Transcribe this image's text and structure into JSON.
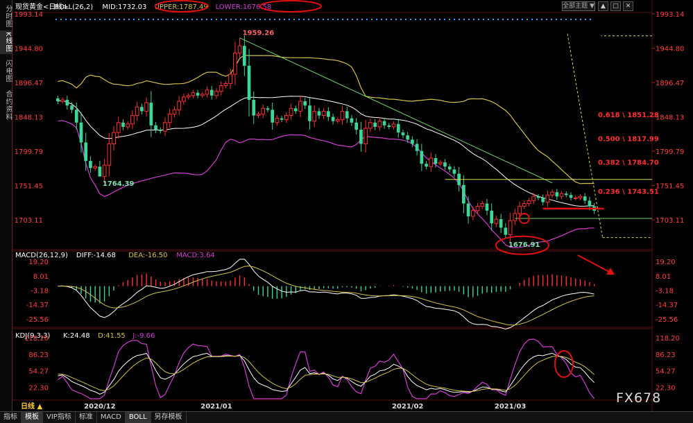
{
  "sidebar_tabs": [
    "分时图",
    "K线图",
    "闪电图",
    "合约资料"
  ],
  "top_button": "全部主题 ▼",
  "window_buttons": [
    "▲",
    "□",
    "✕"
  ],
  "main_panel": {
    "legend": [
      {
        "text": "现货黄金<日线>",
        "color": "#ffffff"
      },
      {
        "text": "BOLL(26,2)",
        "color": "#ffffff"
      },
      {
        "text": "MID:1732.03",
        "color": "#ffffff"
      },
      {
        "text": "UPPER:1787.49",
        "color": "#d4c24a"
      },
      {
        "text": "LOWER:1676.58",
        "color": "#d23fd2"
      }
    ],
    "y_ticks": [
      1993.14,
      1944.8,
      1896.47,
      1848.13,
      1799.79,
      1751.45,
      1703.11
    ],
    "y_ticks_text": [
      "1993.14",
      "1944.80",
      "1896.47",
      "1848.13",
      "1799.79",
      "1751.45",
      "1703.11"
    ],
    "high_label": "1959.26",
    "low_label_left": "1764.39",
    "low_label_right": "1676.91",
    "fib_levels": [
      {
        "ratio": "0.618",
        "price": 1851.28,
        "text": "0.618 \\ 1851.28"
      },
      {
        "ratio": "0.500",
        "price": 1817.99,
        "text": "0.500 \\ 1817.99"
      },
      {
        "ratio": "0.382",
        "price": 1784.7,
        "text": "0.382 \\ 1784.70"
      },
      {
        "ratio": "0.236",
        "price": 1743.51,
        "text": "0.236 \\ 1743.51"
      }
    ]
  },
  "macd_panel": {
    "legend": [
      {
        "text": "MACD(26,12,9)",
        "color": "#ffffff"
      },
      {
        "text": "DIFF:-14.68",
        "color": "#ffffff"
      },
      {
        "text": "DEA:-16.50",
        "color": "#d4c24a"
      },
      {
        "text": "MACD:3.64",
        "color": "#d23fd2"
      }
    ],
    "y_ticks": [
      19.2,
      8.01,
      -3.18,
      -14.37,
      -25.56
    ],
    "y_ticks_text": [
      "19.20",
      "8.01",
      "-3.18",
      "-14.37",
      "-25.56"
    ]
  },
  "kdj_panel": {
    "legend": [
      {
        "text": "KDJ(9,3,3)",
        "color": "#ffffff"
      },
      {
        "text": "K:24.48",
        "color": "#ffffff"
      },
      {
        "text": "D:41.55",
        "color": "#d4c24a"
      },
      {
        "text": "J:-9.66",
        "color": "#d23fd2"
      }
    ],
    "y_ticks": [
      118.2,
      86.23,
      54.27,
      22.3
    ],
    "y_ticks_text": [
      "118.20",
      "86.23",
      "54.27",
      "22.30"
    ]
  },
  "x_labels": [
    "2020/12",
    "2021/01",
    "2021/02",
    "2021/03"
  ],
  "period_label": "日线 ▲",
  "bottom_tabs": [
    "指标",
    "模板",
    "VIP指标",
    "标准",
    "MACD",
    "BOLL",
    "另存模板"
  ],
  "watermark": "FX678",
  "colors": {
    "up": "#ff3030",
    "down": "#3dd598",
    "mid": "#ffffff",
    "upper": "#d4c24a",
    "lower": "#d23fd2",
    "annotation": "#e01010",
    "axis_red": "#ff4040"
  },
  "chart_data": {
    "type": "candlestick",
    "title": "现货黄金<日线>",
    "period": "daily",
    "x_range": [
      "2020-11-18",
      "2021-03-19"
    ],
    "ylim": [
      1665,
      1995
    ],
    "key_points": [
      {
        "label": "high",
        "date": "2021-01-06",
        "value": 1959.26
      },
      {
        "label": "low",
        "date": "2020-11-30",
        "value": 1764.39
      },
      {
        "label": "low",
        "date": "2021-03-08",
        "value": 1676.91
      }
    ],
    "closes": [
      1870,
      1872,
      1864,
      1858,
      1840,
      1812,
      1786,
      1776,
      1778,
      1764,
      1780,
      1810,
      1826,
      1840,
      1834,
      1838,
      1850,
      1862,
      1856,
      1868,
      1836,
      1830,
      1828,
      1840,
      1852,
      1858,
      1870,
      1876,
      1878,
      1882,
      1878,
      1880,
      1886,
      1878,
      1884,
      1892,
      1895,
      1908,
      1938,
      1948,
      1920,
      1872,
      1850,
      1852,
      1860,
      1858,
      1840,
      1846,
      1844,
      1850,
      1860,
      1856,
      1870,
      1864,
      1842,
      1856,
      1850,
      1856,
      1848,
      1842,
      1844,
      1856,
      1846,
      1840,
      1830,
      1810,
      1832,
      1840,
      1834,
      1842,
      1836,
      1834,
      1838,
      1826,
      1822,
      1816,
      1810,
      1800,
      1782,
      1778,
      1790,
      1782,
      1784,
      1778,
      1774,
      1768,
      1752,
      1726,
      1708,
      1716,
      1722,
      1726,
      1716,
      1698,
      1704,
      1692,
      1682,
      1702,
      1712,
      1722,
      1726,
      1730,
      1736,
      1734,
      1728,
      1738,
      1742,
      1736,
      1740,
      1738,
      1734,
      1734,
      1736,
      1730,
      1722,
      1716
    ],
    "boll": {
      "upper": 1787.49,
      "mid": 1732.03,
      "lower": 1676.58
    },
    "macd": {
      "diff": -14.68,
      "dea": -16.5,
      "macd": 3.64,
      "ylim": [
        -30,
        22
      ]
    },
    "kdj": {
      "k": 24.48,
      "d": 41.55,
      "j": -9.66,
      "ylim": [
        0,
        125
      ]
    },
    "fibonacci": [
      {
        "ratio": 0.618,
        "value": 1851.28
      },
      {
        "ratio": 0.5,
        "value": 1817.99
      },
      {
        "ratio": 0.382,
        "value": 1784.7
      },
      {
        "ratio": 0.236,
        "value": 1743.51
      }
    ],
    "x_tick_labels": [
      "2020/12",
      "2021/01",
      "2021/02",
      "2021/03"
    ]
  }
}
